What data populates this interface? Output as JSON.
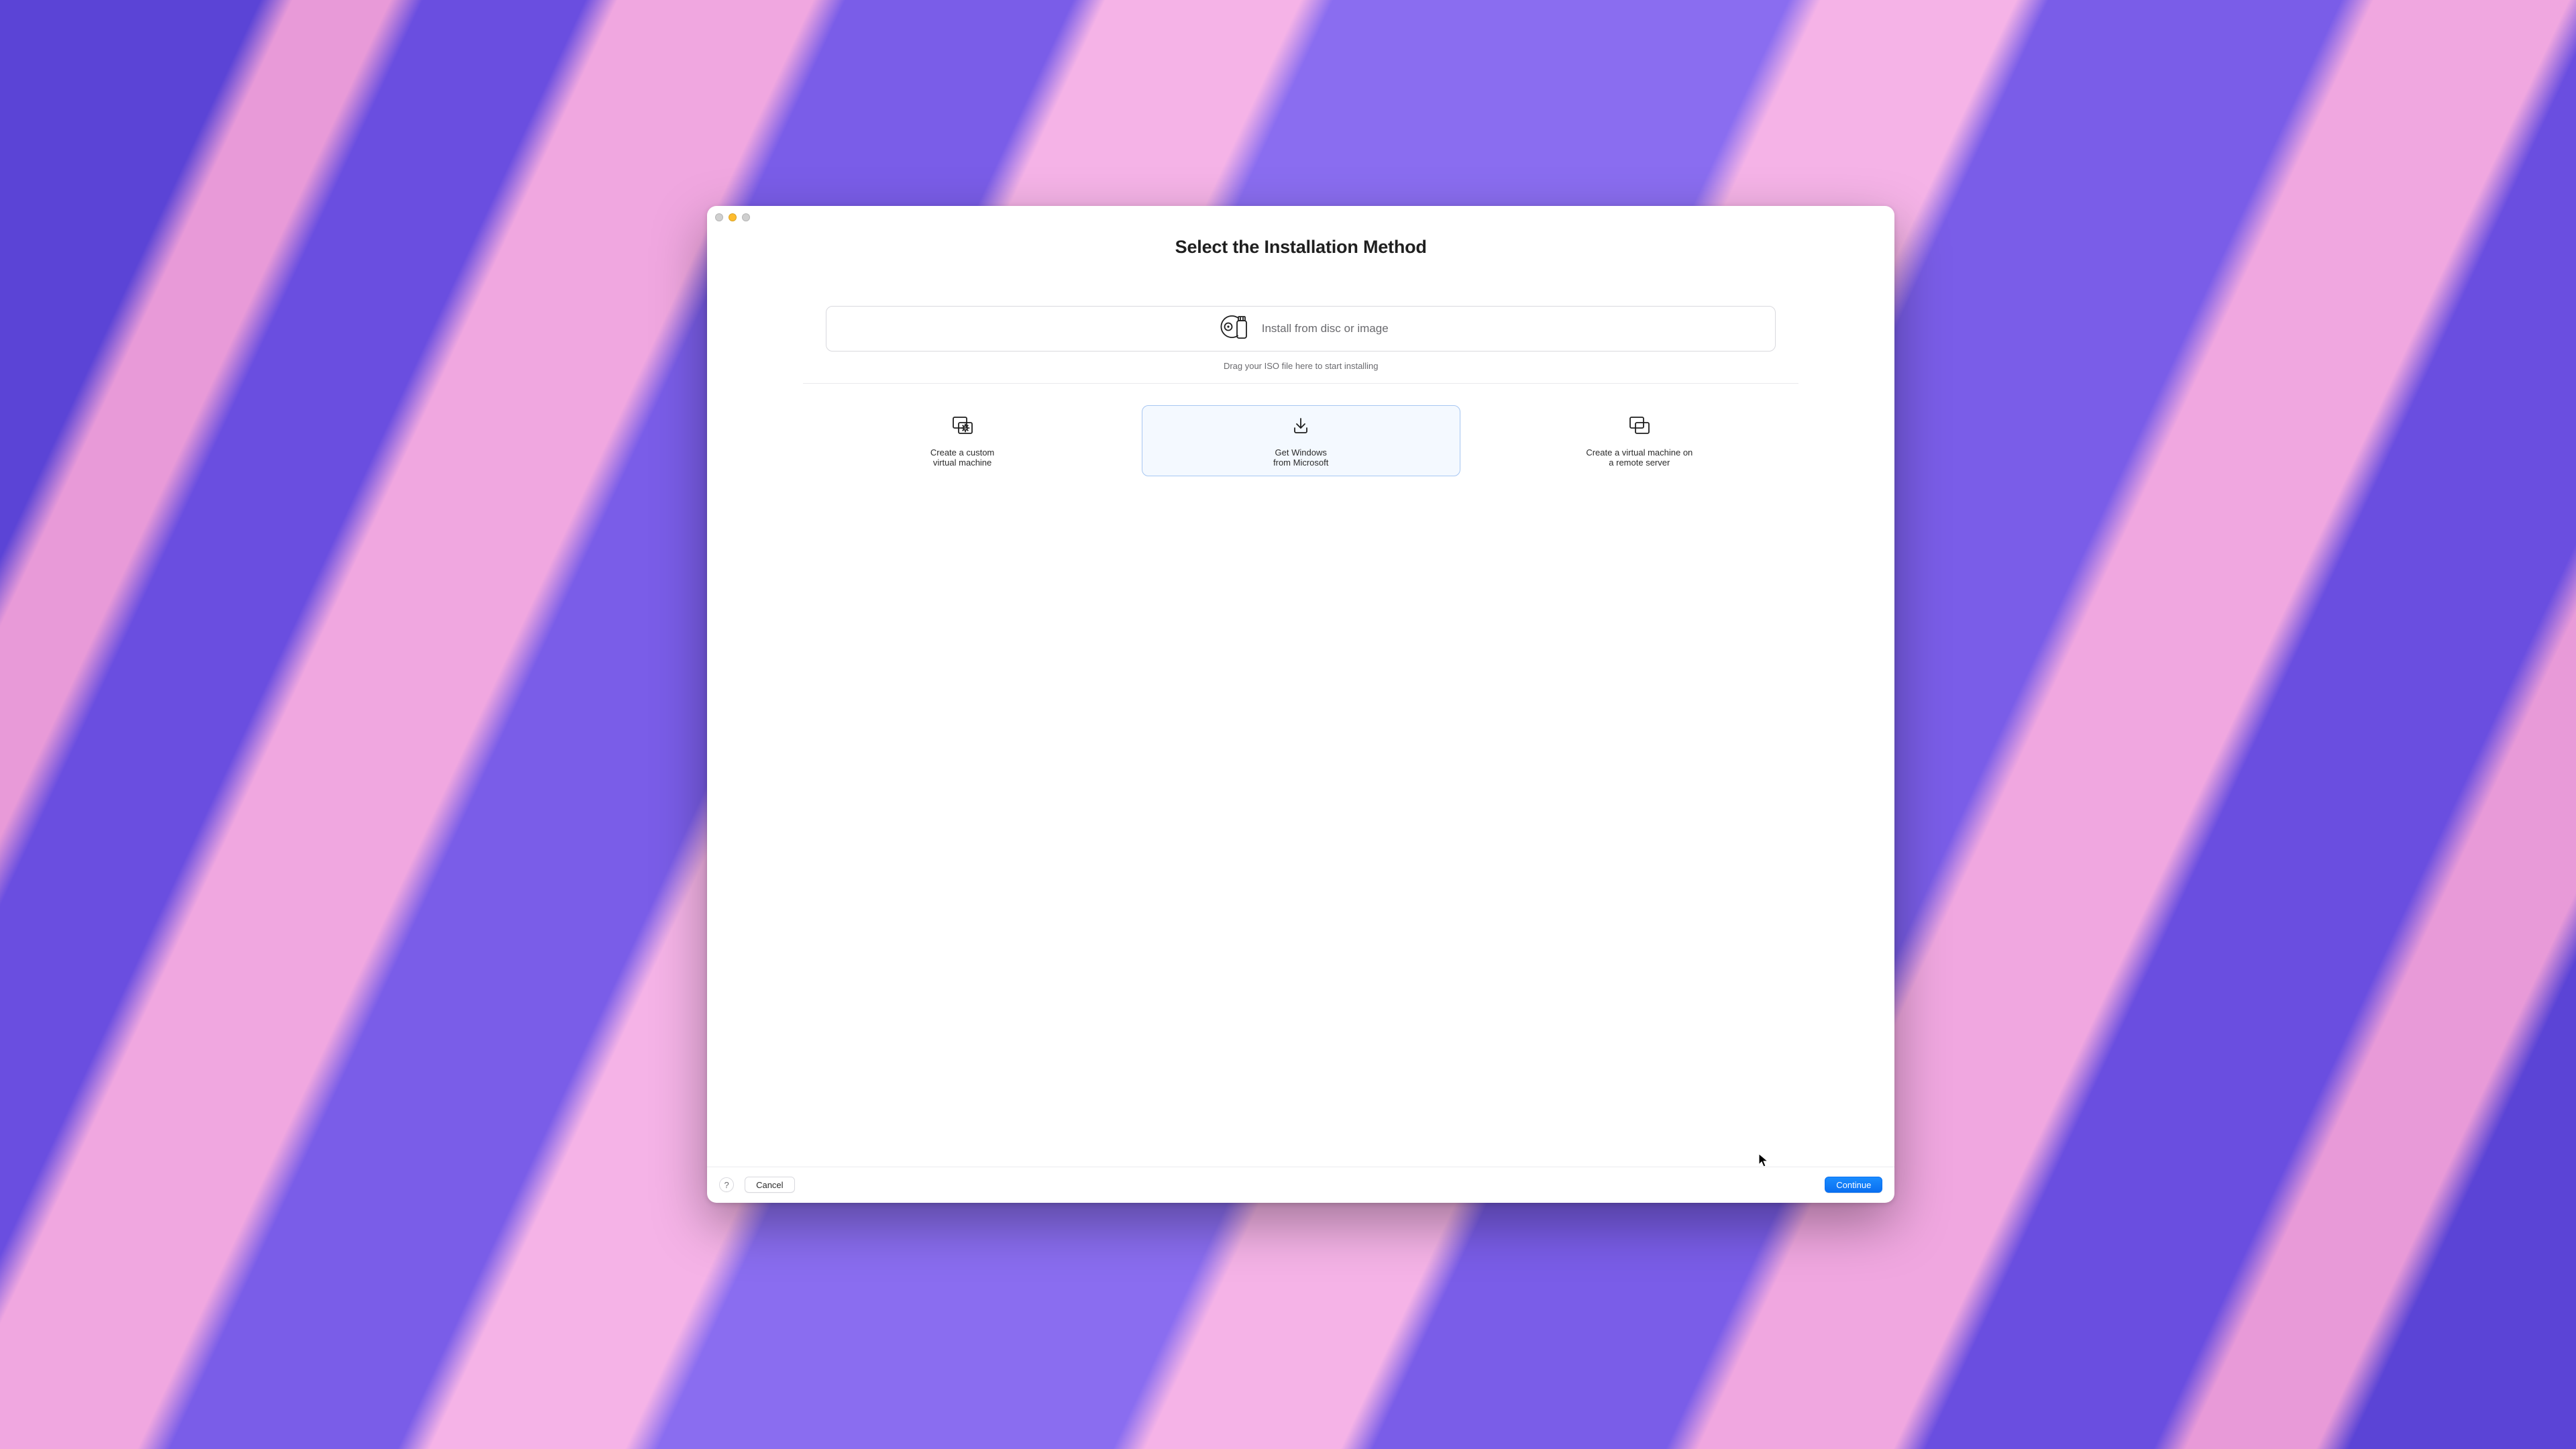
{
  "dialog": {
    "title": "Select the Installation Method",
    "dropzone_label": "Install from disc or image",
    "dropzone_hint": "Drag your ISO file here to start installing"
  },
  "options": {
    "custom_vm": "Create a custom\nvirtual machine",
    "get_windows": "Get Windows\nfrom Microsoft",
    "remote_vm": "Create a virtual machine on\na remote server"
  },
  "footer": {
    "help_label": "?",
    "cancel_label": "Cancel",
    "continue_label": "Continue"
  },
  "colors": {
    "accent": "#0a6ff0",
    "selection_border": "#a7c7f2",
    "selection_bg": "#f4f9ff"
  },
  "selected_option": "get_windows"
}
